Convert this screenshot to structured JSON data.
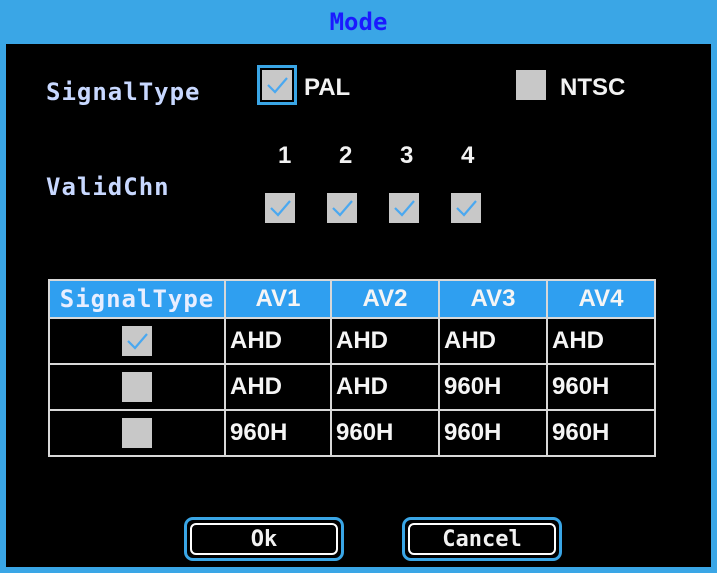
{
  "title": "Mode",
  "signal_type": {
    "label": "SignalType",
    "options": [
      {
        "label": "PAL",
        "checked": true
      },
      {
        "label": "NTSC",
        "checked": false
      }
    ]
  },
  "valid_chn": {
    "label": "ValidChn",
    "channels": [
      {
        "number": "1",
        "checked": true
      },
      {
        "number": "2",
        "checked": true
      },
      {
        "number": "3",
        "checked": true
      },
      {
        "number": "4",
        "checked": true
      }
    ]
  },
  "table": {
    "headers": [
      "SignalType",
      "AV1",
      "AV2",
      "AV3",
      "AV4"
    ],
    "rows": [
      {
        "checked": true,
        "cells": [
          "AHD",
          "AHD",
          "AHD",
          "AHD"
        ]
      },
      {
        "checked": false,
        "cells": [
          "AHD",
          "AHD",
          "960H",
          "960H"
        ]
      },
      {
        "checked": false,
        "cells": [
          "960H",
          "960H",
          "960H",
          "960H"
        ]
      }
    ]
  },
  "buttons": {
    "ok": "Ok",
    "cancel": "Cancel"
  },
  "colors": {
    "accent": "#3aa6e6",
    "header_bg": "#2f9ff0",
    "title_text": "#1a1aff",
    "checkbox": "#c8c8c8"
  }
}
